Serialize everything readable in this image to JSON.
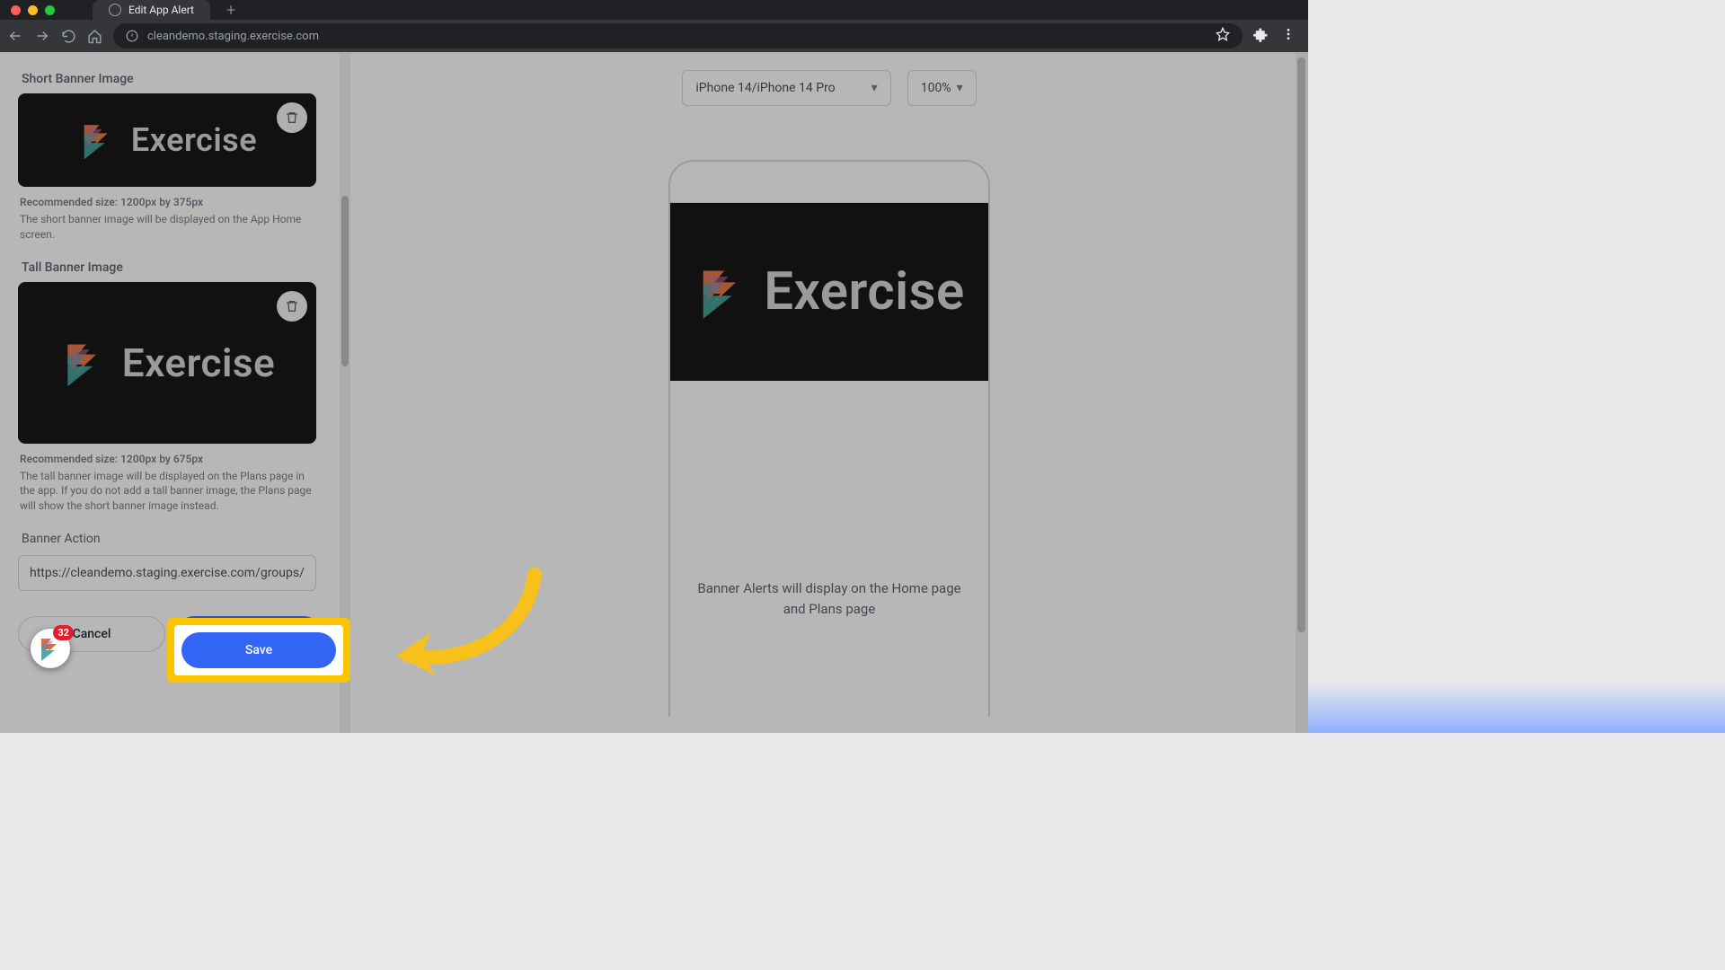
{
  "browser": {
    "tab_title": "Edit App Alert",
    "url": "cleandemo.staging.exercise.com"
  },
  "sidebar": {
    "short_banner": {
      "label": "Short Banner Image",
      "rec": "Recommended size: 1200px by 375px",
      "desc": "The short banner image will be displayed on the App Home screen."
    },
    "tall_banner": {
      "label": "Tall Banner Image",
      "rec": "Recommended size: 1200px by 675px",
      "desc": "The tall banner image will be displayed on the Plans page in the app. If you do not add a tall banner image, the Plans page will show the short banner image instead."
    },
    "action": {
      "label": "Banner Action",
      "value": "https://cleandemo.staging.exercise.com/groups/weekl"
    },
    "cancel": "Cancel",
    "save": "Save"
  },
  "preview": {
    "device": "iPhone 14/iPhone 14 Pro",
    "zoom": "100%",
    "placeholder": "Banner Alerts will display on the Home page and Plans page"
  },
  "brand": {
    "name": "Exercise"
  },
  "badge_count": "32"
}
